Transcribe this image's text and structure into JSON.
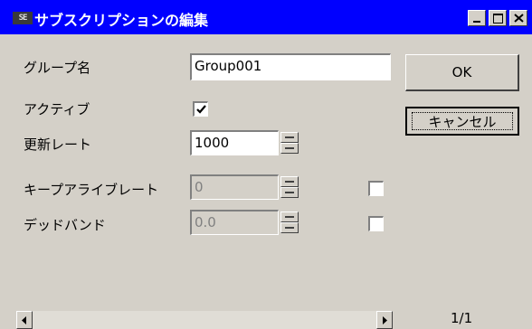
{
  "window": {
    "app_icon_text": "SE",
    "title": "サブスクリプションの編集"
  },
  "fields": {
    "group_name": {
      "label": "グループ名",
      "value": "Group001"
    },
    "active": {
      "label": "アクティブ",
      "checked": true
    },
    "update_rate": {
      "label": "更新レート",
      "value": "1000"
    },
    "keepalive_rate": {
      "label": "キープアライブレート",
      "value": "0",
      "checked": false
    },
    "deadband": {
      "label": "デッドバンド",
      "value": "0.0",
      "checked": false
    }
  },
  "buttons": {
    "ok": "OK",
    "cancel": "キャンセル"
  },
  "pager": {
    "indicator": "1/1"
  },
  "icons": [
    "minimize-icon",
    "maximize-icon",
    "close-icon",
    "checkmark-icon",
    "arrow-left-icon",
    "arrow-right-icon"
  ],
  "colors": {
    "titlebar": "#0000ff",
    "window_bg": "#d4d0c8",
    "disabled_text": "#808080"
  }
}
